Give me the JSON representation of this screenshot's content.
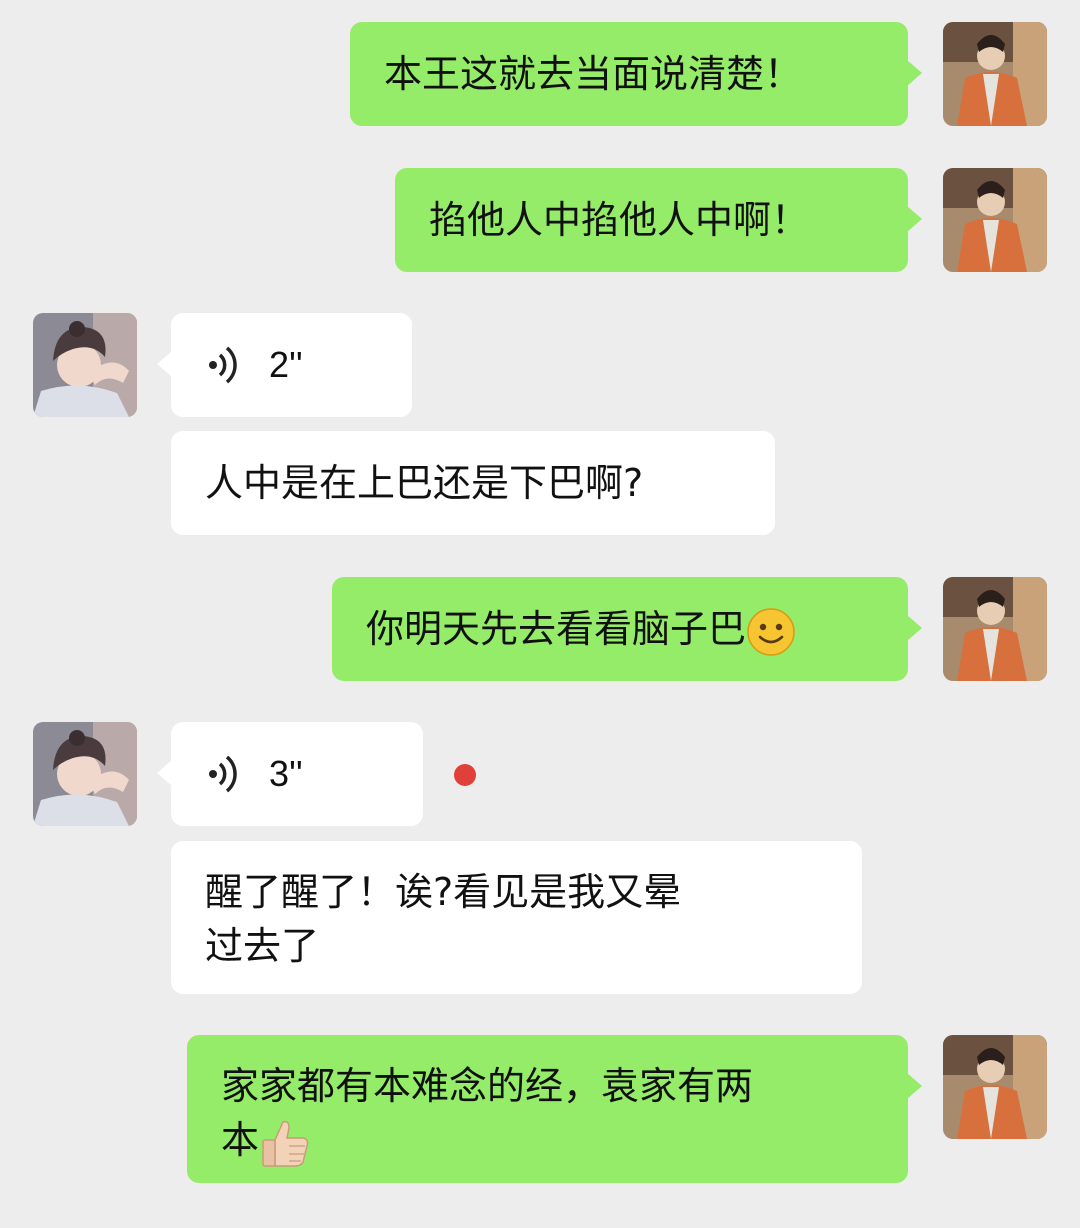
{
  "colors": {
    "background": "#ededed",
    "outgoing_bubble": "#95ec69",
    "incoming_bubble": "#ffffff",
    "unread_dot": "#e0403a"
  },
  "messages": [
    {
      "direction": "outgoing",
      "type": "text",
      "text": "本王这就去当面说清楚！"
    },
    {
      "direction": "outgoing",
      "type": "text",
      "text": "掐他人中掐他人中啊！"
    },
    {
      "direction": "incoming",
      "type": "voice",
      "duration": "2''",
      "icon": "voice-wave-icon"
    },
    {
      "direction": "incoming",
      "type": "text",
      "text": "人中是在上巴还是下巴啊?"
    },
    {
      "direction": "outgoing",
      "type": "text",
      "text": "你明天先去看看脑子巴",
      "emoji": "smile-emoji"
    },
    {
      "direction": "incoming",
      "type": "voice",
      "duration": "3''",
      "icon": "voice-wave-icon",
      "unread": true
    },
    {
      "direction": "incoming",
      "type": "text",
      "lines": [
        "醒了醒了！诶?看见是我又晕",
        "过去了"
      ]
    },
    {
      "direction": "outgoing",
      "type": "text",
      "lines": [
        "家家都有本难念的经，袁家有两",
        "本"
      ],
      "emoji": "thumbs-up-emoji"
    }
  ]
}
